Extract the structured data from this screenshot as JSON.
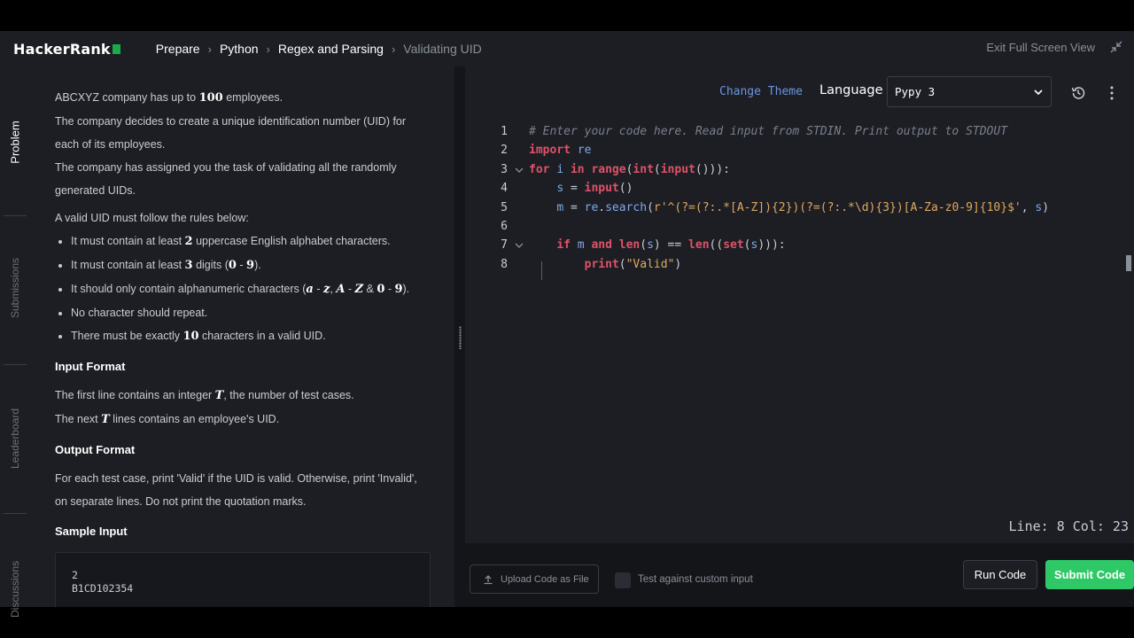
{
  "header": {
    "logo_text": "HackerRank",
    "breadcrumbs": [
      "Prepare",
      "Python",
      "Regex and Parsing",
      "Validating UID"
    ],
    "exit_label": "Exit Full Screen View"
  },
  "sidenav": {
    "tabs": [
      "Problem",
      "Submissions",
      "Leaderboard",
      "Discussions"
    ]
  },
  "problem": {
    "intro1": [
      "ABCXYZ company has up to ",
      "100",
      " employees."
    ],
    "intro2": "The company decides to create a unique identification number (UID) for each of its employees.",
    "intro3": "The company has assigned you the task of validating all the randomly generated UIDs.",
    "rules_heading": "A valid UID must follow the rules below:",
    "rules": [
      [
        "It must contain at least ",
        "2",
        " uppercase English alphabet characters."
      ],
      [
        "It must contain at least ",
        "3",
        " digits (",
        "0",
        " - ",
        "9",
        ")."
      ],
      [
        "It should only contain alphanumeric characters (",
        "a",
        " - ",
        "z",
        ", ",
        "A",
        " - ",
        "Z",
        " & ",
        "0",
        " - ",
        "9",
        ")."
      ],
      [
        "No character should repeat."
      ],
      [
        "There must be exactly ",
        "10",
        " characters in a valid UID."
      ]
    ],
    "input_heading": "Input Format",
    "input_line1": [
      "The first line contains an integer ",
      "T",
      ", the number of test cases."
    ],
    "input_line2": [
      "The next ",
      "T",
      " lines contains an employee's UID."
    ],
    "output_heading": "Output Format",
    "output_text": "For each test case, print 'Valid' if the UID is valid. Otherwise, print 'Invalid', on separate lines. Do not print the quotation marks.",
    "sample_heading": "Sample Input",
    "sample_lines": [
      "2",
      "B1CD102354"
    ]
  },
  "editor": {
    "change_theme": "Change Theme",
    "language_label": "Language",
    "language_value": "Pypy 3",
    "lines": [
      {
        "n": "1",
        "tokens": [
          [
            "cm",
            "# Enter your code here. Read input from STDIN. Print output to STDOUT"
          ]
        ]
      },
      {
        "n": "2",
        "tokens": [
          [
            "kw",
            "import"
          ],
          [
            "pl",
            " "
          ],
          [
            "id",
            "re"
          ]
        ]
      },
      {
        "n": "3",
        "fold": true,
        "tokens": [
          [
            "kw",
            "for"
          ],
          [
            "pl",
            " "
          ],
          [
            "id",
            "i"
          ],
          [
            "pl",
            " "
          ],
          [
            "kw",
            "in"
          ],
          [
            "pl",
            " "
          ],
          [
            "bi",
            "range"
          ],
          [
            "pl",
            "("
          ],
          [
            "bi",
            "int"
          ],
          [
            "pl",
            "("
          ],
          [
            "bi",
            "input"
          ],
          [
            "pl",
            "())):"
          ]
        ]
      },
      {
        "n": "4",
        "tokens": [
          [
            "pl",
            "    "
          ],
          [
            "id",
            "s"
          ],
          [
            "pl",
            " = "
          ],
          [
            "bi",
            "input"
          ],
          [
            "pl",
            "()"
          ]
        ]
      },
      {
        "n": "5",
        "tokens": [
          [
            "pl",
            "    "
          ],
          [
            "id",
            "m"
          ],
          [
            "pl",
            " = "
          ],
          [
            "id",
            "re"
          ],
          [
            "pl",
            "."
          ],
          [
            "id",
            "search"
          ],
          [
            "pl",
            "("
          ],
          [
            "st",
            "r'^(?=(?:.*[A-Z]){2})(?=(?:.*\\d){3})[A-Za-z0-9]{10}$'"
          ],
          [
            "pl",
            ", "
          ],
          [
            "id",
            "s"
          ],
          [
            "pl",
            ")"
          ]
        ]
      },
      {
        "n": "6",
        "tokens": []
      },
      {
        "n": "7",
        "fold": true,
        "tokens": [
          [
            "pl",
            "    "
          ],
          [
            "kw",
            "if"
          ],
          [
            "pl",
            " "
          ],
          [
            "id",
            "m"
          ],
          [
            "pl",
            " "
          ],
          [
            "kw",
            "and"
          ],
          [
            "pl",
            " "
          ],
          [
            "bi",
            "len"
          ],
          [
            "pl",
            "("
          ],
          [
            "id",
            "s"
          ],
          [
            "pl",
            ") == "
          ],
          [
            "bi",
            "len"
          ],
          [
            "pl",
            "(("
          ],
          [
            "bi",
            "set"
          ],
          [
            "pl",
            "("
          ],
          [
            "id",
            "s"
          ],
          [
            "pl",
            "))):"
          ]
        ]
      },
      {
        "n": "8",
        "tokens": [
          [
            "pl",
            "        "
          ],
          [
            "bi",
            "print"
          ],
          [
            "pl",
            "("
          ],
          [
            "st",
            "\"Valid\""
          ],
          [
            "pl",
            ")"
          ]
        ]
      }
    ],
    "status": "Line: 8 Col: 23"
  },
  "footer": {
    "upload_label": "Upload Code as File",
    "custom_input_label": "Test against custom input",
    "run_label": "Run Code",
    "submit_label": "Submit Code"
  }
}
